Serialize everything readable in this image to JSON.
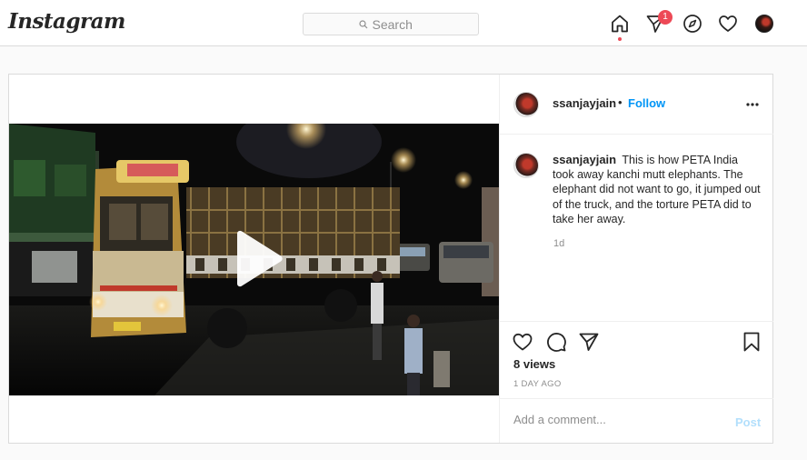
{
  "nav": {
    "logo_text": "Instagram",
    "search_placeholder": "Search",
    "notification_count": "1",
    "icons": [
      "home-icon",
      "direct-message-icon",
      "explore-compass-icon",
      "activity-heart-icon",
      "profile-avatar"
    ]
  },
  "post": {
    "author": "ssanjayjain",
    "follow_label": "Follow",
    "separator": "•",
    "caption_user": "ssanjayjain",
    "caption_text": "This is how PETA India took away kanchi mutt elephants. The elephant did not want to go, it jumped out of the truck, and the torture PETA did to take her away.",
    "caption_time": "1d",
    "views": "8 views",
    "posted_ago": "1 DAY AGO",
    "comment_placeholder": "Add a comment...",
    "post_button": "Post",
    "media_type": "video"
  },
  "colors": {
    "accent": "#0095f6",
    "badge": "#ed4956",
    "post_disabled": "#b2dffc",
    "border": "#dbdbdb",
    "background": "#fafafa"
  }
}
